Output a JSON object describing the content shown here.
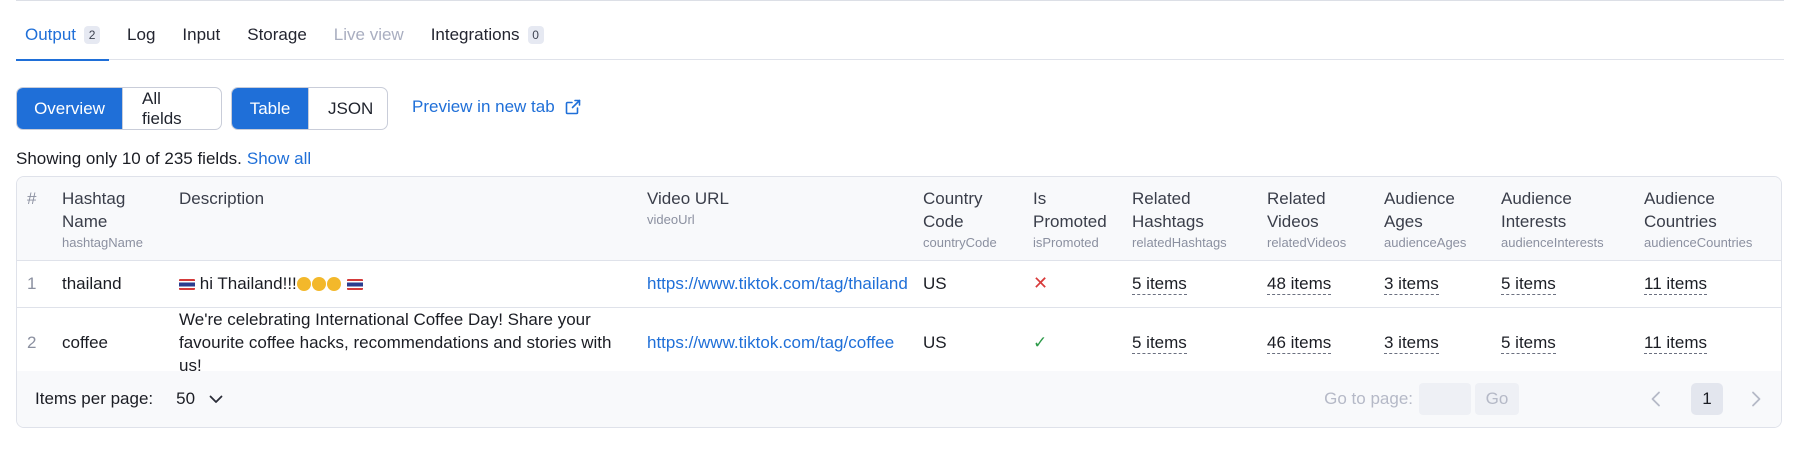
{
  "tabs": [
    {
      "label": "Output",
      "count": "2",
      "state": "active"
    },
    {
      "label": "Log",
      "count": null,
      "state": "normal"
    },
    {
      "label": "Input",
      "count": null,
      "state": "normal"
    },
    {
      "label": "Storage",
      "count": null,
      "state": "normal"
    },
    {
      "label": "Live view",
      "count": null,
      "state": "disabled"
    },
    {
      "label": "Integrations",
      "count": "0",
      "state": "normal"
    }
  ],
  "toolbar": {
    "view_mode": {
      "overview": "Overview",
      "all_fields": "All fields",
      "selected": "Overview"
    },
    "format": {
      "table": "Table",
      "json": "JSON",
      "selected": "Table"
    },
    "preview_link": "Preview in new tab"
  },
  "fields_notice": {
    "text": "Showing only 10 of 235 fields.",
    "show_all": "Show all"
  },
  "table": {
    "columns": [
      {
        "title": "#",
        "key": ""
      },
      {
        "title": "Hashtag Name",
        "key": "hashtagName"
      },
      {
        "title": "Description",
        "key": ""
      },
      {
        "title": "Video URL",
        "key": "videoUrl"
      },
      {
        "title": "Country Code",
        "key": "countryCode"
      },
      {
        "title": "Is Promoted",
        "key": "isPromoted"
      },
      {
        "title": "Related Hashtags",
        "key": "relatedHashtags"
      },
      {
        "title": "Related Videos",
        "key": "relatedVideos"
      },
      {
        "title": "Audience Ages",
        "key": "audienceAges"
      },
      {
        "title": "Audience Interests",
        "key": "audienceInterests"
      },
      {
        "title": "Audience Countries",
        "key": "audienceCountries"
      }
    ],
    "rows": [
      {
        "num": "1",
        "hashtag": "thailand",
        "description": "hi Thailand!!!",
        "url": "https://www.tiktok.com/tag/thailand",
        "country": "US",
        "promoted": "✕",
        "related_hashtags": "5 items",
        "related_videos": "48 items",
        "audience_ages": "3 items",
        "audience_interests": "5 items",
        "audience_countries": "11 items"
      },
      {
        "num": "2",
        "hashtag": "coffee",
        "description": "We're celebrating International Coffee Day! Share your favourite coffee hacks, recommendations and stories with us!",
        "url": "https://www.tiktok.com/tag/coffee",
        "country": "US",
        "promoted": "✓",
        "related_hashtags": "5 items",
        "related_videos": "46 items",
        "audience_ages": "3 items",
        "audience_interests": "5 items",
        "audience_countries": "11 items"
      }
    ]
  },
  "footer": {
    "items_per_page_label": "Items per page:",
    "items_per_page_value": "50",
    "goto_label": "Go to page:",
    "goto_button": "Go",
    "current_page": "1"
  },
  "colors": {
    "accent": "#1f6fd8",
    "false_mark": "#d83a3a",
    "true_mark": "#2e9b4a"
  },
  "icons": [
    "external-link-icon",
    "chevron-down-icon",
    "chevron-left-icon",
    "chevron-right-icon",
    "cross-icon",
    "check-icon",
    "thai-flag-icon",
    "emoji-icon"
  ]
}
